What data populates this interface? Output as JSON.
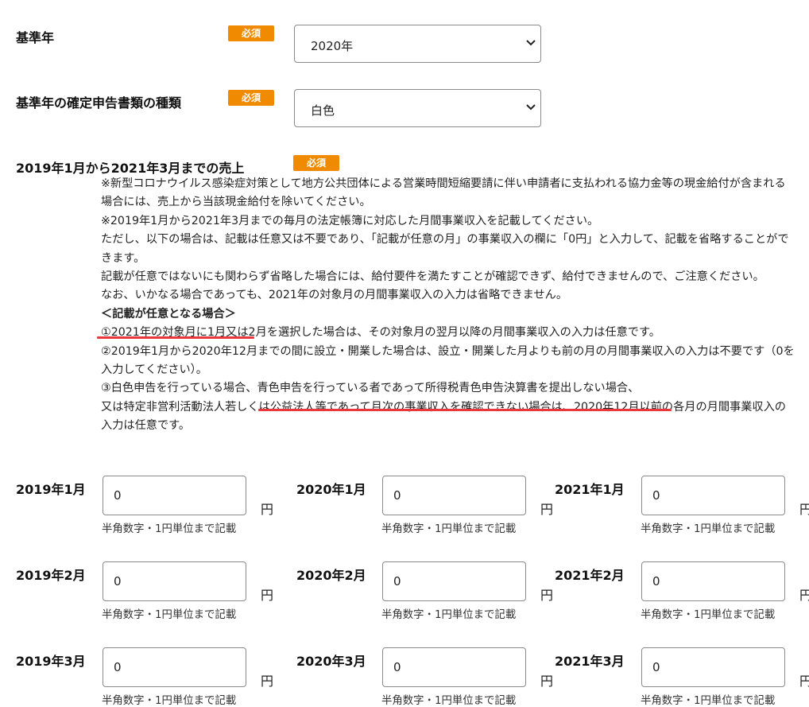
{
  "required_badge": "必須",
  "base_year": {
    "label": "基準年",
    "value": "2020年"
  },
  "filing_type": {
    "label": "基準年の確定申告書類の種類",
    "value": "白色"
  },
  "sales": {
    "label": "2019年1月から2021年3月までの売上"
  },
  "notes": [
    "※新型コロナウイルス感染症対策として地方公共団体による営業時間短縮要請に伴い申請者に支払われる協力金等の現金給付が含まれる場合には、売上から当該現金給付を除いてください。",
    "※2019年1月から2021年3月までの毎月の法定帳簿に対応した月間事業収入を記載してください。",
    "ただし、以下の場合は、記載は任意又は不要であり、「記載が任意の月」の事業収入の欄に「0円」と入力して、記載を省略することができます。",
    "記載が任意ではないにも関わらず省略した場合には、給付要件を満たすことが確認できず、給付できませんので、ご注意ください。",
    "なお、いかなる場合であっても、2021年の対象月の月間事業収入の入力は省略できません。",
    "＜記載が任意となる場合＞",
    "①2021年の対象月に1月又は2月を選択した場合は、その対象月の翌月以降の月間事業収入の入力は任意です。",
    "②2019年1月から2020年12月までの間に設立・開業した場合は、設立・開業した月よりも前の月の月間事業収入の入力は不要です（0を入力してください）。",
    "③白色申告を行っている場合、青色申告を行っている者であって所得税青色申告決算書を提出しない場合、",
    "又は特定非営利活動法人若しくは公益法人等であって月次の事業収入を確認できない場合は、2020年12月以前の各月の月間事業収入の入力は任意です。"
  ],
  "unit": "円",
  "hint": "半角数字・1円単位まで記載",
  "months": [
    [
      {
        "label": "2019年1月",
        "value": "0"
      },
      {
        "label": "2020年1月",
        "value": "0"
      },
      {
        "label": "2021年1月",
        "value": "0"
      }
    ],
    [
      {
        "label": "2019年2月",
        "value": "0"
      },
      {
        "label": "2020年2月",
        "value": "0"
      },
      {
        "label": "2021年2月",
        "value": "0"
      }
    ],
    [
      {
        "label": "2019年3月",
        "value": "0"
      },
      {
        "label": "2020年3月",
        "value": "0"
      },
      {
        "label": "2021年3月",
        "value": "0"
      }
    ]
  ],
  "colors": {
    "badge": "#f08a00",
    "underline": "#e8383d"
  }
}
